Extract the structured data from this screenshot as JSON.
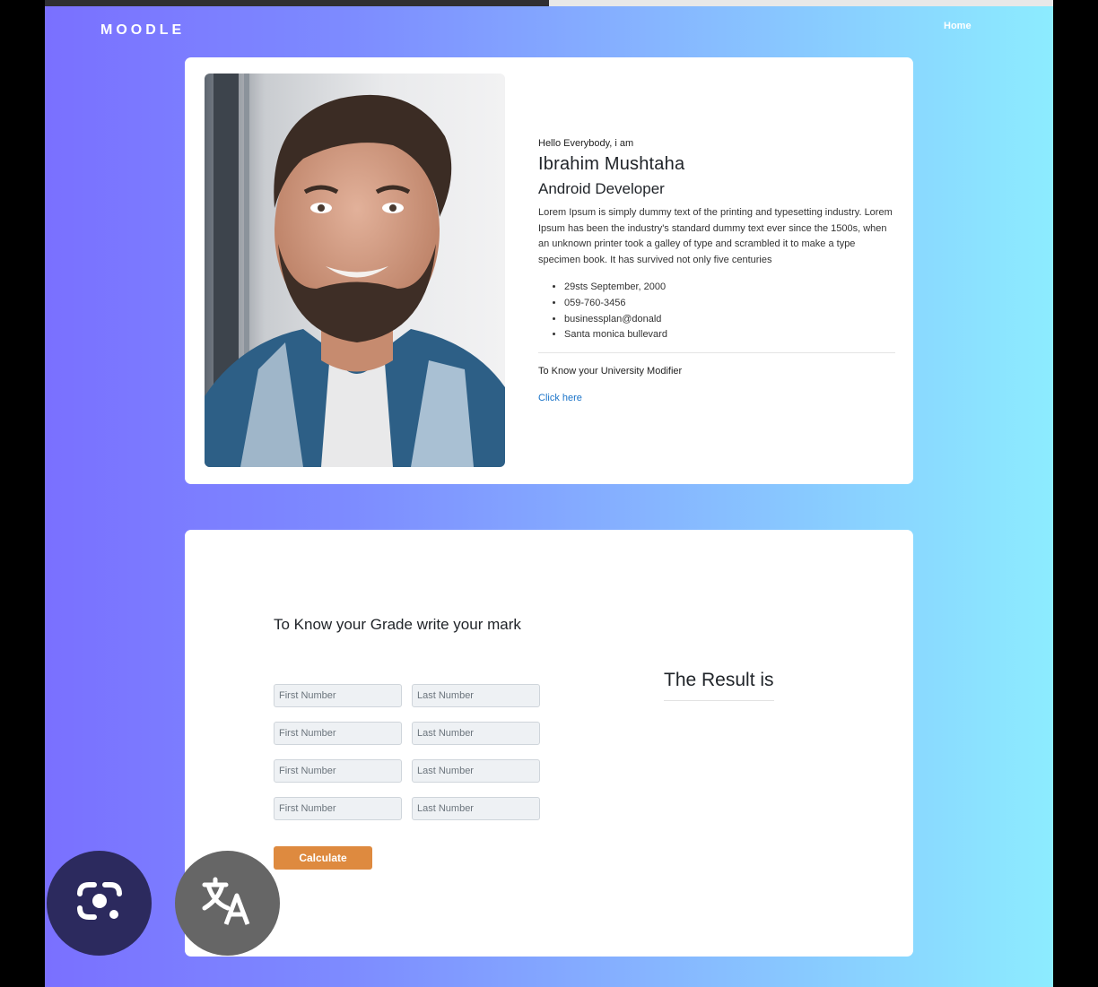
{
  "nav": {
    "brand": "MOODLE",
    "home": "Home"
  },
  "profile": {
    "greeting": "Hello Everybody, i am",
    "name": "Ibrahim Mushtaha",
    "role": "Android Developer",
    "description": "Lorem Ipsum is simply dummy text of the printing and typesetting industry. Lorem Ipsum has been the industry's standard dummy text ever since the 1500s, when an unknown printer took a galley of type and scrambled it to make a type specimen book. It has survived not only five centuries",
    "facts": [
      "29sts September, 2000",
      "059-760-3456",
      "businessplan@donald",
      "Santa monica bullevard"
    ],
    "modifier_title": "To Know your University Modifier",
    "link": "Click here"
  },
  "grade": {
    "title": "To Know your Grade write your mark",
    "first_placeholder": "First Number",
    "last_placeholder": "Last Number",
    "button": "Calculate",
    "result_title": "The Result is"
  },
  "colors": {
    "gradient_start": "#7a70ff",
    "gradient_end": "#8cecff",
    "button": "#de8a3f",
    "link": "#1a73c8"
  },
  "overlay": {
    "icons": [
      "camera-lens-icon",
      "translate-icon"
    ]
  }
}
